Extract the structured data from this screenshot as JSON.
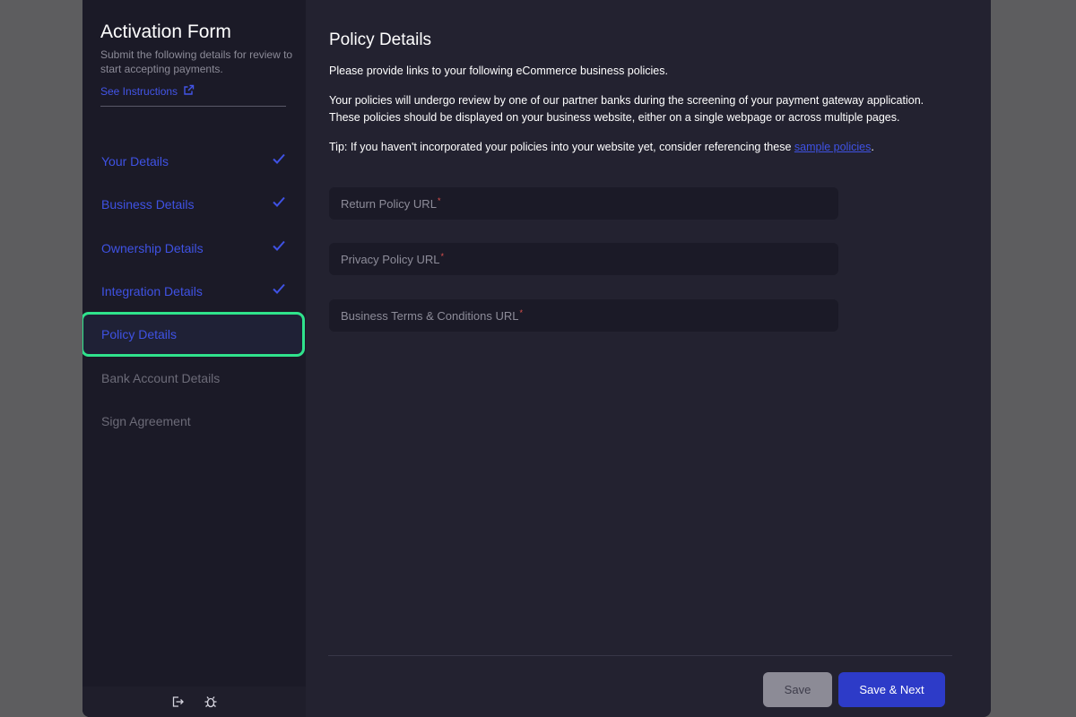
{
  "sidebar": {
    "title": "Activation Form",
    "subtitle": "Submit the following details for review to start accepting payments.",
    "instructions_link": "See Instructions",
    "items": [
      {
        "label": "Your Details",
        "status": "done"
      },
      {
        "label": "Business Details",
        "status": "done"
      },
      {
        "label": "Ownership Details",
        "status": "done"
      },
      {
        "label": "Integration Details",
        "status": "done"
      },
      {
        "label": "Policy Details",
        "status": "active"
      },
      {
        "label": "Bank Account Details",
        "status": "pending"
      },
      {
        "label": "Sign Agreement",
        "status": "pending"
      }
    ],
    "footer_icons": [
      "logout-icon",
      "bug-icon"
    ]
  },
  "main": {
    "title": "Policy Details",
    "intro": "Please provide links to your following eCommerce business policies.",
    "review_text": "Your policies will undergo review by one of our partner banks during the screening of your payment gateway application. These policies should be displayed on your business website, either on a single webpage or across multiple pages.",
    "tip_prefix": "Tip: If you haven't incorporated your policies into your website yet, consider referencing these ",
    "tip_link": "sample policies",
    "tip_suffix": ".",
    "fields": [
      {
        "placeholder": "Return Policy URL",
        "required_mark": "*",
        "value": ""
      },
      {
        "placeholder": "Privacy Policy URL",
        "required_mark": "*",
        "value": ""
      },
      {
        "placeholder": "Business Terms & Conditions URL",
        "required_mark": "*",
        "value": ""
      }
    ]
  },
  "buttons": {
    "save": "Save",
    "save_next": "Save & Next"
  },
  "colors": {
    "accent": "#3f52e4",
    "active_outline": "#2fe38c",
    "primary_button": "#2d3bc8",
    "required": "#e0524e"
  }
}
